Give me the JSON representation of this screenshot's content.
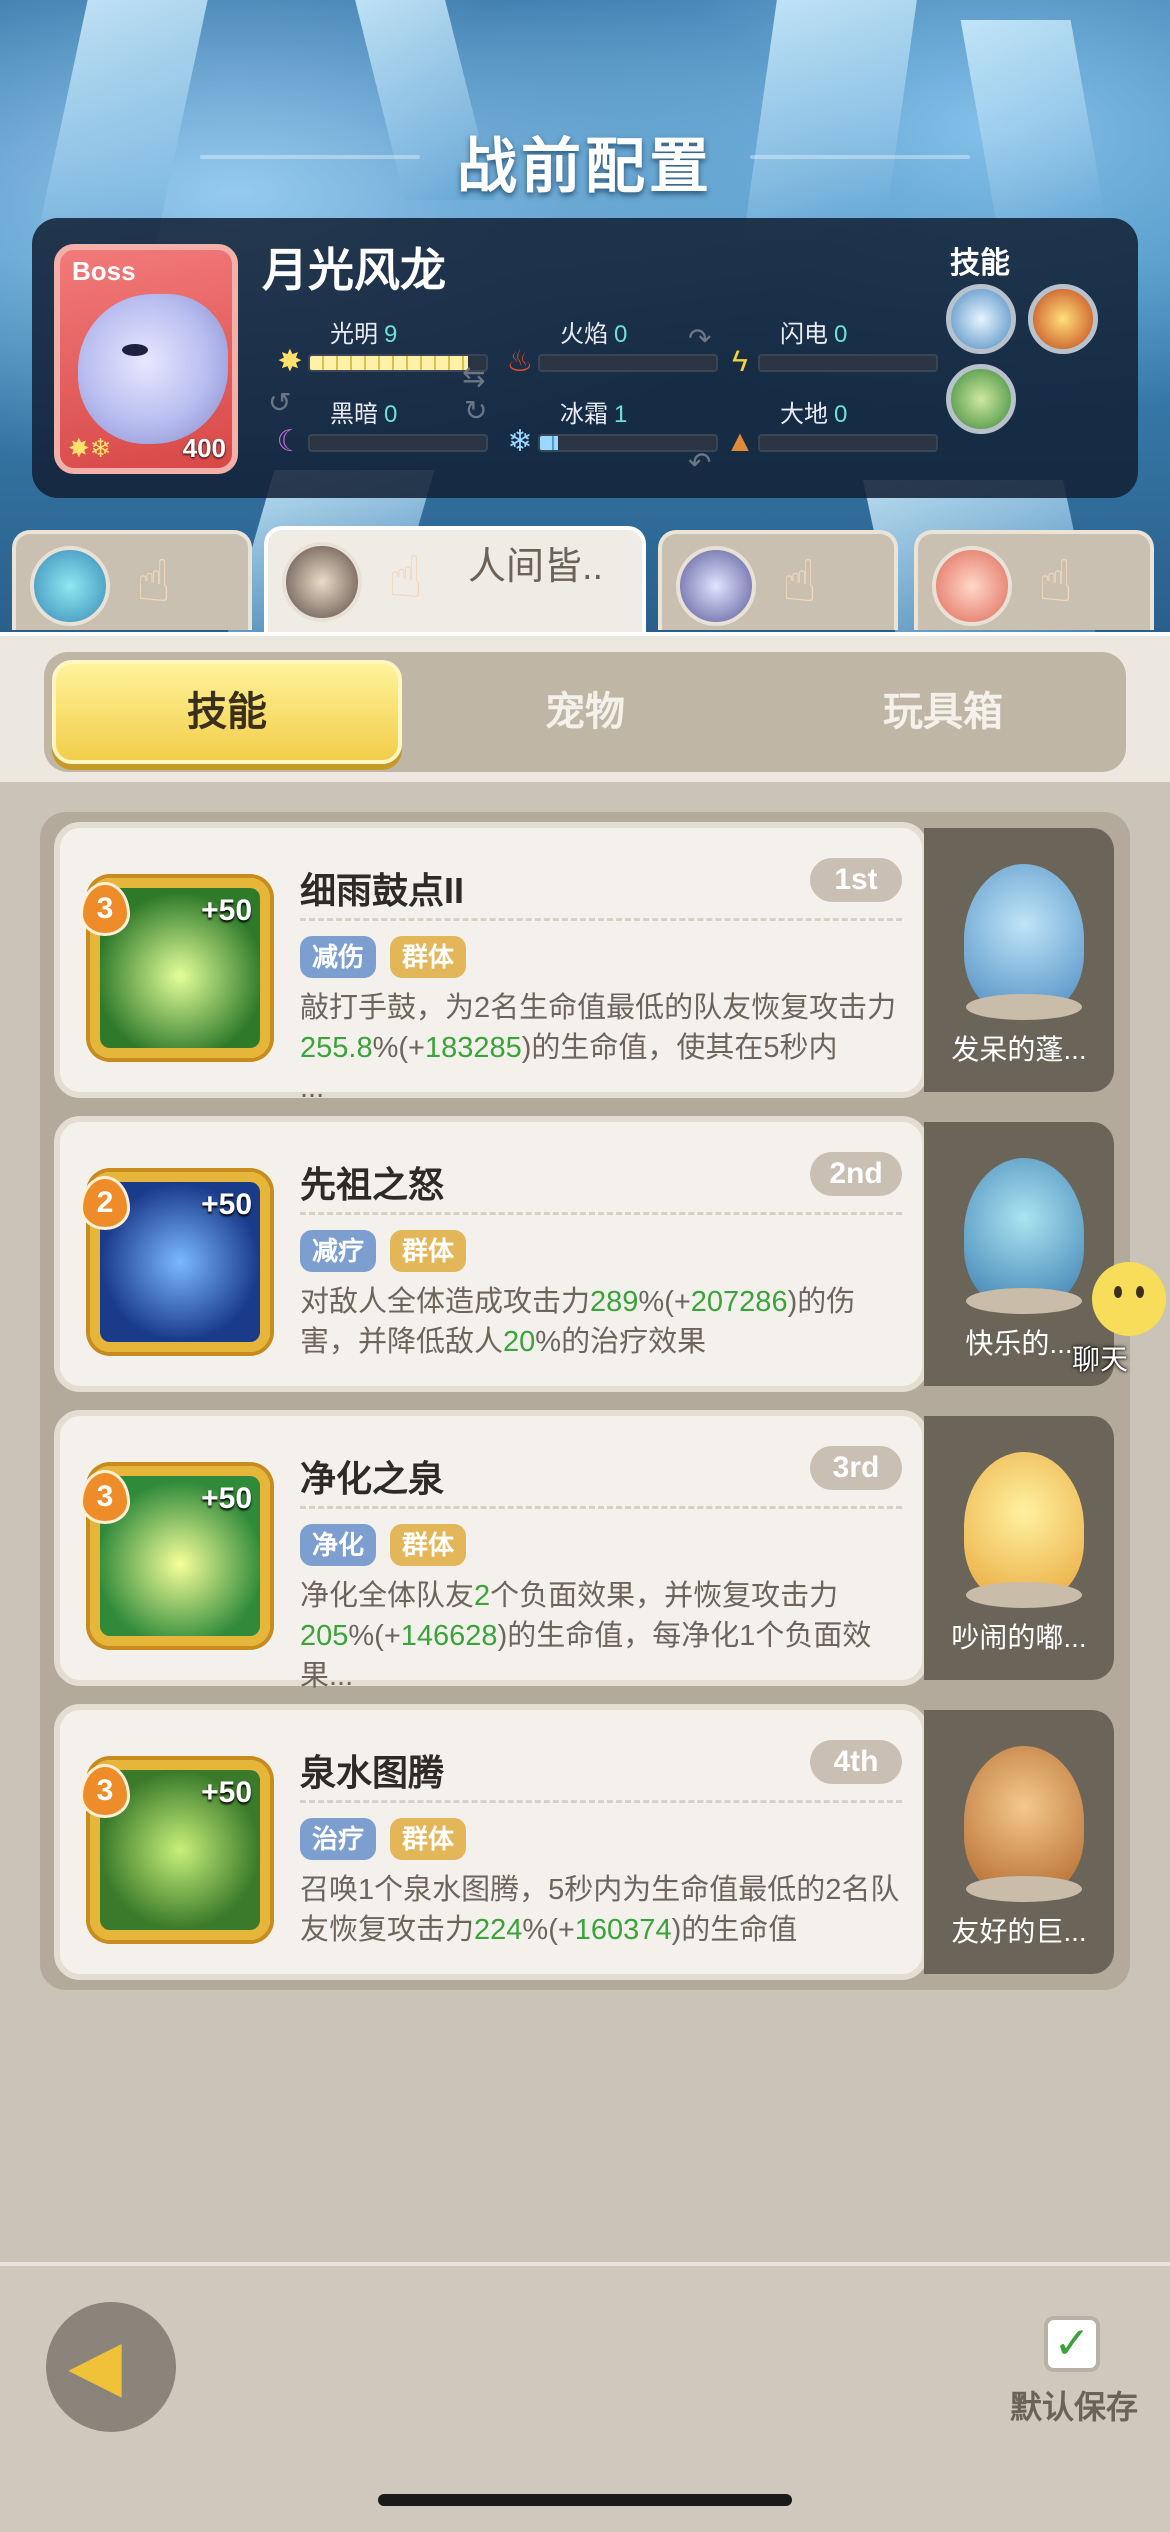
{
  "screen": {
    "title": "战前配置"
  },
  "boss": {
    "tag": "Boss",
    "name": "月光风龙",
    "level": "400",
    "elements": [
      {
        "label": "光明",
        "value": "9",
        "icon": "sun-icon",
        "fill": 0.9
      },
      {
        "label": "火焰",
        "value": "0",
        "icon": "flame-icon",
        "fill": 0
      },
      {
        "label": "闪电",
        "value": "0",
        "icon": "lightning-icon",
        "fill": 0
      },
      {
        "label": "黑暗",
        "value": "0",
        "icon": "moon-icon",
        "fill": 0
      },
      {
        "label": "冰霜",
        "value": "1",
        "icon": "snowflake-icon",
        "fill": 0.1
      },
      {
        "label": "大地",
        "value": "0",
        "icon": "earth-icon",
        "fill": 0
      }
    ],
    "skills_label": "技能"
  },
  "team_tabs": [
    {
      "name": "",
      "active": false
    },
    {
      "name": "人间皆..",
      "active": true
    },
    {
      "name": "",
      "active": false
    },
    {
      "name": "",
      "active": false
    }
  ],
  "segments": {
    "skills": "技能",
    "pets": "宠物",
    "toybox": "玩具箱",
    "selected": "技能"
  },
  "skills": [
    {
      "level": "3",
      "bonus": "+50",
      "name": "细雨鼓点II",
      "rank": "1st",
      "tags": [
        "减伤",
        "群体"
      ],
      "desc_parts": [
        "敲打手鼓，为2名生命值最低的队友恢复攻击力",
        "255.8",
        "%(+",
        "183285",
        ")的生命值，使其在5秒内",
        "",
        "..."
      ],
      "pet_name": "发呆的蓬..."
    },
    {
      "level": "2",
      "bonus": "+50",
      "name": "先祖之怒",
      "rank": "2nd",
      "tags": [
        "减疗",
        "群体"
      ],
      "desc_parts": [
        "对敌人全体造成攻击力",
        "289",
        "%(+",
        "207286",
        ")的伤害，并降低敌人",
        "20",
        "%的治疗效果"
      ],
      "pet_name": "快乐的..."
    },
    {
      "level": "3",
      "bonus": "+50",
      "name": "净化之泉",
      "rank": "3rd",
      "tags": [
        "净化",
        "群体"
      ],
      "desc_parts": [
        "净化全体队友",
        "2",
        "个负面效果，并恢复攻击力",
        "205",
        "%(+",
        "146628",
        ")的生命值，每净化1个负面效果..."
      ],
      "pet_name": "吵闹的嘟..."
    },
    {
      "level": "3",
      "bonus": "+50",
      "name": "泉水图腾",
      "rank": "4th",
      "tags": [
        "治疗",
        "群体"
      ],
      "desc_parts": [
        "召唤1个泉水图腾，5秒内为生命值最低的2名队友恢复攻击力",
        "224",
        "%(+",
        "160374",
        ")的生命值",
        "",
        ""
      ],
      "pet_name": "友好的巨..."
    }
  ],
  "chat": {
    "label": "聊天"
  },
  "bottom": {
    "save_label": "默认保存"
  }
}
